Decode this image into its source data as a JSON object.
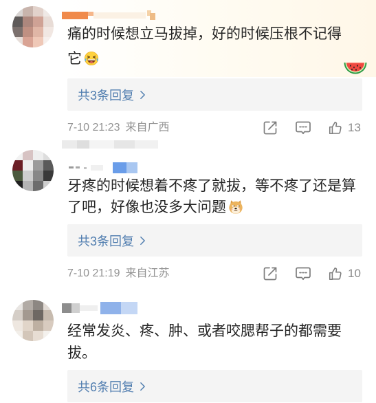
{
  "colors": {
    "text": "#262626",
    "link": "#507daf",
    "meta": "#939393",
    "reply_background": "#f4f4f4",
    "icon": "#7d7d7d"
  },
  "icons": {
    "repost": "repost-icon",
    "comment": "comment-icon",
    "like": "like-icon",
    "chevron": "chevron-right-icon",
    "decoration": "watermelon-icon"
  },
  "comments": [
    {
      "text": "痛的时候想立马拔掉，好的时候压根不记得它",
      "emoji": "laugh-cry-emoji-icon",
      "replies_label": "共3条回复",
      "time": "7-10 21:23",
      "location": "来自广西",
      "likes": 13
    },
    {
      "text": "牙疼的时候想着不疼了就拔，等不疼了还是算了吧，好像也没多大问题",
      "emoji": "doge-emoji-icon",
      "replies_label": "共3条回复",
      "time": "7-10 21:19",
      "location": "来自江苏",
      "likes": 10
    },
    {
      "text": "经常发炎、疼、肿、或者咬腮帮子的都需要拔。",
      "replies_label": "共6条回复"
    }
  ]
}
